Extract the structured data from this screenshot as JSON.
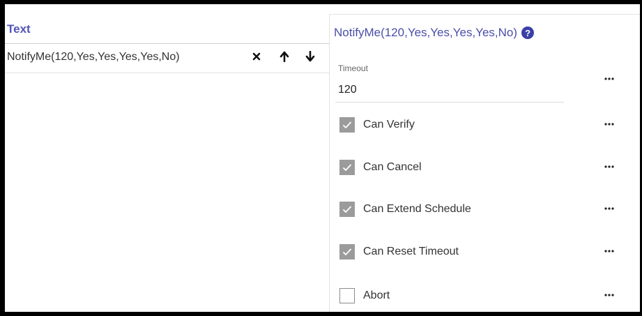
{
  "list": {
    "header": "Text",
    "items": [
      {
        "text": "NotifyMe(120,Yes,Yes,Yes,Yes,No)"
      }
    ]
  },
  "icons": {
    "remove": "close-icon",
    "move_up": "arrow-up-icon",
    "move_down": "arrow-down-icon",
    "help": "help-circle-icon",
    "more": "more-horizontal-icon",
    "check": "check-icon"
  },
  "detail": {
    "title": "NotifyMe(120,Yes,Yes,Yes,Yes,No)",
    "help_glyph": "?",
    "timeout": {
      "label": "Timeout",
      "value": "120"
    },
    "options": [
      {
        "label": "Can Verify",
        "checked": true
      },
      {
        "label": "Can Cancel",
        "checked": true
      },
      {
        "label": "Can Extend Schedule",
        "checked": true
      },
      {
        "label": "Can Reset Timeout",
        "checked": true
      },
      {
        "label": "Abort",
        "checked": false
      }
    ]
  },
  "colors": {
    "accent": "#5355b8",
    "checked_box": "#9b9b9b",
    "help_icon": "#3a3fa8"
  }
}
